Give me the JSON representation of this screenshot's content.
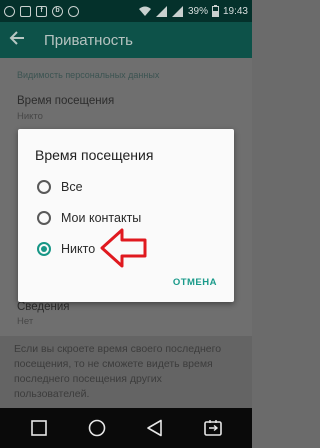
{
  "status_bar": {
    "battery": "39%",
    "time": "19:43",
    "icons": [
      "whatsapp-icon",
      "image-icon",
      "facebook-icon",
      "b-icon",
      "circle-icon",
      "wifi-icon",
      "signal-icon",
      "battery-icon"
    ],
    "left_glyphs": [
      "",
      "",
      "f",
      "b",
      ""
    ]
  },
  "app_bar": {
    "title": "Приватность"
  },
  "settings": {
    "section_title": "Видимость персональных данных",
    "items": [
      {
        "title": "Время посещения",
        "value": "Никто"
      },
      {
        "title": "Сведения",
        "value": "Нет"
      }
    ]
  },
  "footnote": "Если вы скроете время своего последнего посещения, то не сможете видеть время последнего посещения других пользователей.",
  "dialog": {
    "title": "Время посещения",
    "options": [
      {
        "label": "Все",
        "selected": false
      },
      {
        "label": "Мои контакты",
        "selected": false
      },
      {
        "label": "Никто",
        "selected": true
      }
    ],
    "cancel_label": "ОТМЕНА"
  },
  "colors": {
    "accent": "#179686",
    "app_bar": "#0d5249",
    "status_bar": "#04312b",
    "annotation_arrow": "#e0191f"
  }
}
